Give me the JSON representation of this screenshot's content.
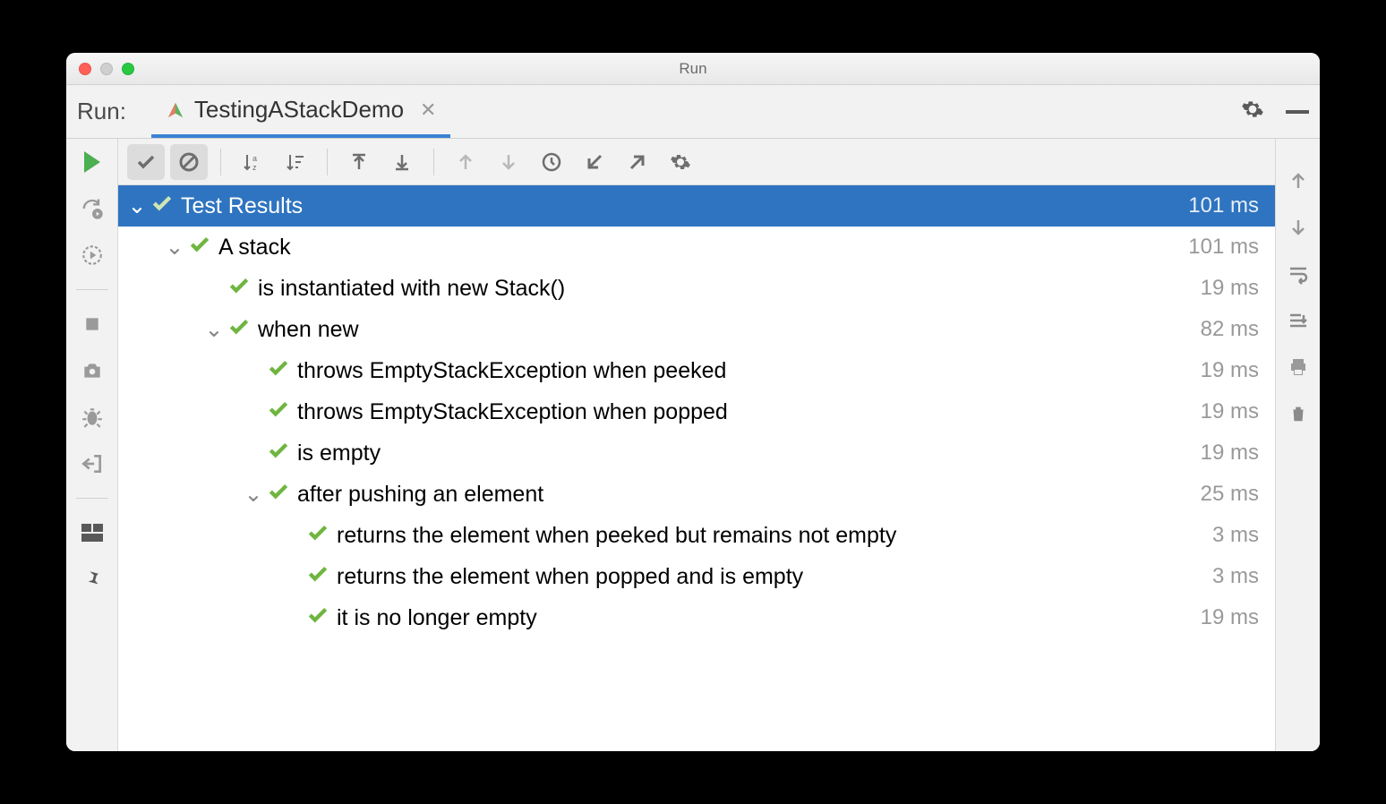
{
  "window": {
    "title": "Run"
  },
  "tabbar": {
    "run_label": "Run:",
    "tab_name": "TestingAStackDemo"
  },
  "tree": {
    "root": {
      "label": "Test Results",
      "time": "101 ms"
    },
    "nodes": [
      {
        "indent": 1,
        "expandable": true,
        "label": "A stack",
        "time": "101 ms"
      },
      {
        "indent": 2,
        "expandable": false,
        "label": "is instantiated with new Stack()",
        "time": "19 ms"
      },
      {
        "indent": 2,
        "expandable": true,
        "label": "when new",
        "time": "82 ms"
      },
      {
        "indent": 3,
        "expandable": false,
        "label": "throws EmptyStackException when peeked",
        "time": "19 ms"
      },
      {
        "indent": 3,
        "expandable": false,
        "label": "throws EmptyStackException when popped",
        "time": "19 ms"
      },
      {
        "indent": 3,
        "expandable": false,
        "label": "is empty",
        "time": "19 ms"
      },
      {
        "indent": 3,
        "expandable": true,
        "label": "after pushing an element",
        "time": "25 ms"
      },
      {
        "indent": 4,
        "expandable": false,
        "label": "returns the element when peeked but remains not empty",
        "time": "3 ms"
      },
      {
        "indent": 4,
        "expandable": false,
        "label": "returns the element when popped and is empty",
        "time": "3 ms"
      },
      {
        "indent": 4,
        "expandable": false,
        "label": "it is no longer empty",
        "time": "19 ms"
      }
    ]
  }
}
